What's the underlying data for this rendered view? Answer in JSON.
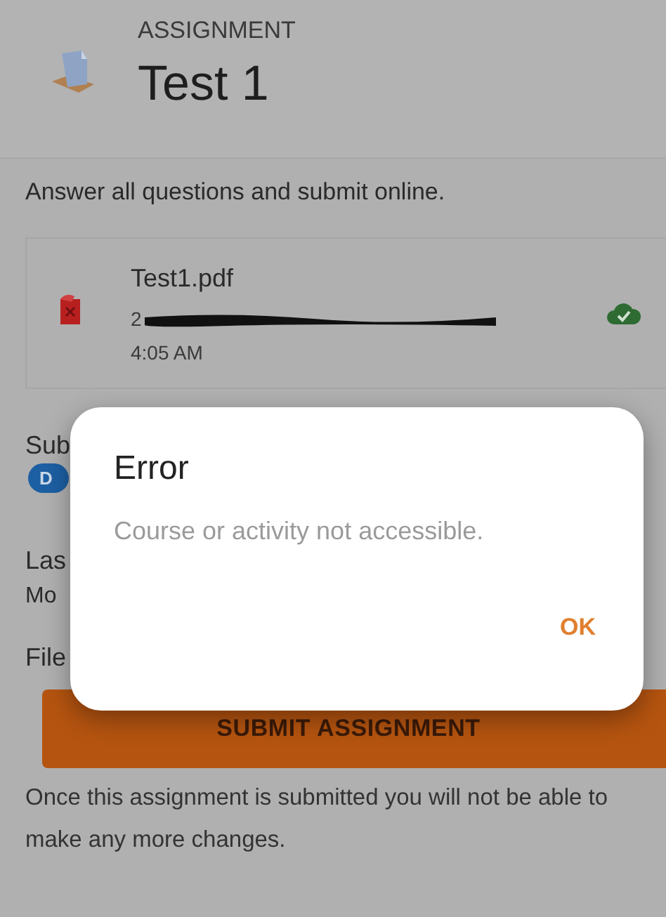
{
  "header": {
    "category": "ASSIGNMENT",
    "title": "Test 1"
  },
  "description": "Answer all questions and submit online.",
  "file": {
    "name": "Test1.pdf",
    "date_visible": "2",
    "time": "4:05 AM"
  },
  "status": {
    "label": "Sub",
    "badge": "D"
  },
  "last_modified": {
    "label": "Las",
    "value": "Mo"
  },
  "file_submissions": {
    "label": "File"
  },
  "submit_button": "SUBMIT ASSIGNMENT",
  "note": "Once this assignment is submitted you will not be able to make any more changes.",
  "dialog": {
    "title": "Error",
    "message": "Course or activity not accessible.",
    "buttons": [
      "OK"
    ]
  }
}
